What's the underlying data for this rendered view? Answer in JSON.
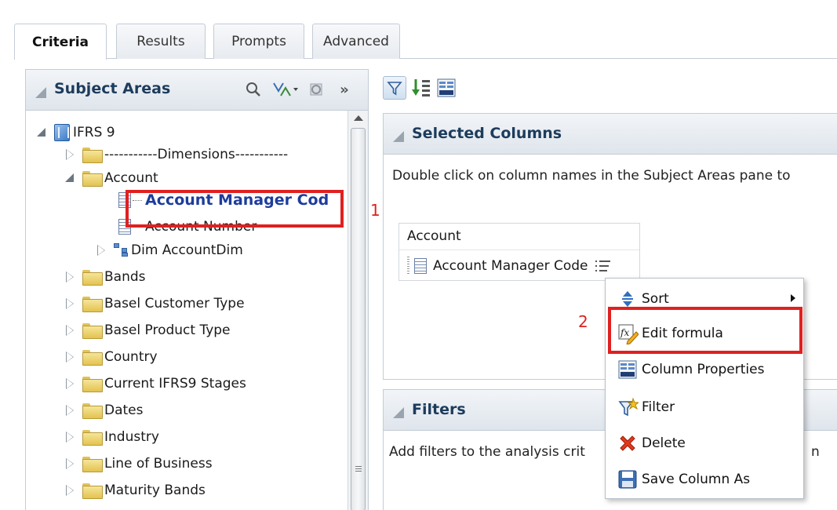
{
  "tabs": [
    {
      "label": "Criteria",
      "active": true
    },
    {
      "label": "Results",
      "active": false
    },
    {
      "label": "Prompts",
      "active": false
    },
    {
      "label": "Advanced",
      "active": false
    }
  ],
  "subject_areas": {
    "title": "Subject Areas",
    "header_icons": [
      "search-icon",
      "sort-options-icon",
      "refresh-icon",
      "expand-pane-icon"
    ],
    "tree": [
      {
        "label": "IFRS 9",
        "kind": "subject-area",
        "state": "open"
      },
      {
        "label": "-----------Dimensions-----------",
        "kind": "folder",
        "state": "closed"
      },
      {
        "label": "Account",
        "kind": "folder",
        "state": "open"
      },
      {
        "label": "Account Manager Cod",
        "kind": "column",
        "selected": true
      },
      {
        "label": "Account Number",
        "kind": "column"
      },
      {
        "label": "Dim AccountDim",
        "kind": "hierarchy",
        "state": "closed"
      },
      {
        "label": "Bands",
        "kind": "folder",
        "state": "closed"
      },
      {
        "label": "Basel Customer Type",
        "kind": "folder",
        "state": "closed"
      },
      {
        "label": "Basel Product Type",
        "kind": "folder",
        "state": "closed"
      },
      {
        "label": "Country",
        "kind": "folder",
        "state": "closed"
      },
      {
        "label": "Current IFRS9 Stages",
        "kind": "folder",
        "state": "closed"
      },
      {
        "label": "Dates",
        "kind": "folder",
        "state": "closed"
      },
      {
        "label": "Industry",
        "kind": "folder",
        "state": "closed"
      },
      {
        "label": "Line of Business",
        "kind": "folder",
        "state": "closed"
      },
      {
        "label": "Maturity Bands",
        "kind": "folder",
        "state": "closed"
      }
    ]
  },
  "toolbar_icons": [
    "filter-icon",
    "sort-icon",
    "column-properties-icon"
  ],
  "selected_columns": {
    "title": "Selected Columns",
    "hint": "Double click on column names in the Subject Areas pane to",
    "table_header": "Account",
    "column": "Account Manager Code"
  },
  "filters": {
    "title": "Filters",
    "hint_left": "Add filters to the analysis crit",
    "hint_right": "n"
  },
  "context_menu": {
    "items": [
      {
        "label": "Sort",
        "icon": "sort-arrows-icon",
        "submenu": true
      },
      {
        "label": "Edit formula",
        "icon": "edit-formula-icon"
      },
      {
        "label": "Column Properties",
        "icon": "column-properties-icon"
      },
      {
        "label": "Filter",
        "icon": "filter-icon"
      },
      {
        "label": "Delete",
        "icon": "delete-icon"
      },
      {
        "label": "Save Column As",
        "icon": "save-icon"
      }
    ]
  },
  "annotations": [
    "1",
    "2"
  ],
  "colors": {
    "annotation": "#e02020",
    "selected_text": "#1d3c9c",
    "header_text": "#1d3c5c"
  }
}
